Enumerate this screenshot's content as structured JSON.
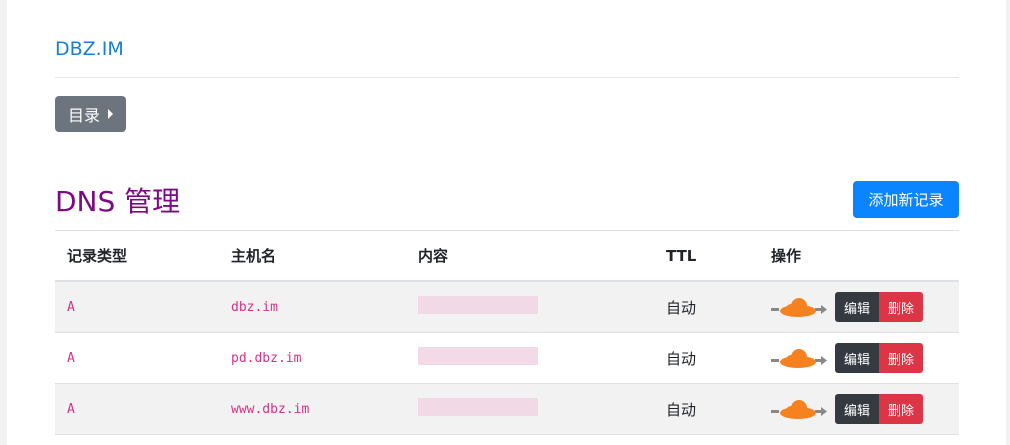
{
  "site": {
    "title": "DBZ.IM"
  },
  "toc": {
    "label": "目录"
  },
  "page": {
    "title": "DNS 管理"
  },
  "add_button": {
    "label": "添加新记录"
  },
  "table": {
    "headers": [
      "记录类型",
      "主机名",
      "内容",
      "TTL",
      "操作"
    ],
    "rows": [
      {
        "type": "A",
        "host": "dbz.im",
        "content": "",
        "ttl": "自动",
        "edit": "编辑",
        "delete": "删除"
      },
      {
        "type": "A",
        "host": "pd.dbz.im",
        "content": "",
        "ttl": "自动",
        "edit": "编辑",
        "delete": "删除"
      },
      {
        "type": "A",
        "host": "www.dbz.im",
        "content": "",
        "ttl": "自动",
        "edit": "编辑",
        "delete": "删除"
      }
    ]
  },
  "colors": {
    "link": "#1a7fd4",
    "title": "#7b0b82",
    "primary": "#0a84ff",
    "danger": "#dc3545",
    "dark": "#343a40",
    "cloud": "#f6821f"
  },
  "icons": {
    "proxy": "cloud-proxy-icon",
    "caret": "caret-right-icon"
  }
}
